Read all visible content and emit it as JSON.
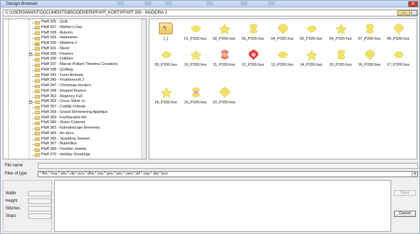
{
  "window": {
    "title": "Design Browser",
    "close_label": "✕",
    "path": "C:\\USERS\\MARIT\\DOCUMENTS\\BRODERIER\\PFAFF_KORT\\PFAFF 330 - MADEIRA 2"
  },
  "tree": {
    "items": [
      {
        "label": "Pfaff 325 - Quilt"
      },
      {
        "label": "Pfaff 327 - Mother's Day"
      },
      {
        "label": "Pfaff 328 - Autumn"
      },
      {
        "label": "Pfaff 329 - Halloween"
      },
      {
        "label": "Pfaff 330 - Madeira 2",
        "open": true
      },
      {
        "label": "Pfaff 331 - Music"
      },
      {
        "label": "Pfaff 335 - Flowers",
        "expandable": true
      },
      {
        "label": "Pfaff 336 - Folklore"
      },
      {
        "label": "Pfaff 337 - Marcie Pollard Timeless Creations"
      },
      {
        "label": "Pfaff 338 - Quilting"
      },
      {
        "label": "Pfaff 342 - Farm Animals"
      },
      {
        "label": "Pfaff 343 - Featherwork 2"
      },
      {
        "label": "Pfaff 347 - Christmas borders"
      },
      {
        "label": "Pfaff 349 - Elegant flowers"
      },
      {
        "label": "Pfaff 352 - Regency Full"
      },
      {
        "label": "Pfaff 353 - Cross Stitch  cc",
        "expandable": true
      },
      {
        "label": "Pfaff 357 - Cuddly Friends"
      },
      {
        "label": "Pfaff 358 - Grand Shimmering Applique"
      },
      {
        "label": "Pfaff 359 - Fashionable Art"
      },
      {
        "label": "Pfaff 360 - Sheer Cutwork"
      },
      {
        "label": "Pfaff 362 - Kaleidoscope Elements"
      },
      {
        "label": "Pfaff 365 - Art deco"
      },
      {
        "label": "Pfaff 366 - Sparkling Season"
      },
      {
        "label": "Pfaff 367 - Butterflies"
      },
      {
        "label": "Pfaff 368 - Fashion Jewels"
      },
      {
        "label": "Pfaff 370 - Holiday Greetings"
      }
    ]
  },
  "files": [
    {
      "label": "[..]",
      "kind": "updir"
    },
    {
      "label": "01_P330.hus",
      "color": "#f2e46a"
    },
    {
      "label": "02_P330.hus",
      "color": "#f0e36e"
    },
    {
      "label": "03_P330.hus",
      "color": "#efe276"
    },
    {
      "label": "04_P330.hus",
      "color": "#f1e067"
    },
    {
      "label": "05_P330.hus",
      "color": "#f3e46c"
    },
    {
      "label": "06_P330.hus",
      "color": "#efe074"
    },
    {
      "label": "07_P330.hus",
      "color": "#f2e26a"
    },
    {
      "label": "08_P330.hus",
      "color": "#f0e270"
    },
    {
      "label": "09_P330.hus",
      "color": "#f1e26c"
    },
    {
      "label": "10_P330.hus",
      "color": "#f2e574"
    },
    {
      "label": "11_P330.hus",
      "color": "#e87aa0",
      "accent": "#f0c94a"
    },
    {
      "label": "12_P330.hus",
      "color": "#e8363a",
      "accent": "#f5b6c8"
    },
    {
      "label": "13_P330.hus",
      "color": "#f0e06a"
    },
    {
      "label": "14_P330.hus",
      "color": "#f1e272"
    },
    {
      "label": "15_P330.hus",
      "color": "#f2e46c"
    },
    {
      "label": "16_P330.hus",
      "color": "#efe270"
    },
    {
      "label": "17_P330.hus",
      "color": "#f1e46a"
    },
    {
      "label": "18_P330.hus",
      "color": "#f2e372"
    },
    {
      "label": "19_P330.hus",
      "color": "#f3e06e",
      "accent": "#f2a0b4"
    },
    {
      "label": "20_P330.hus",
      "color": "#f0e26a"
    }
  ],
  "form": {
    "file_name_label": "File name",
    "file_name_value": "",
    "files_of_type_label": "Files of type",
    "files_of_type_value": "*.fhe,*.hus,*.shv,*.vip,*.pcs,*.dhe,*.xxs,*.pes,*.pec,*.sew,*.jef,*.exp,*.dst,*.pcs",
    "dropdown_arrow": "▾"
  },
  "info": {
    "width_label": "Width",
    "height_label": "Height",
    "stitches_label": "Stitches",
    "stops_label": "Stops"
  },
  "buttons": {
    "open_label": "Open",
    "cancel_label": "Cancel"
  }
}
